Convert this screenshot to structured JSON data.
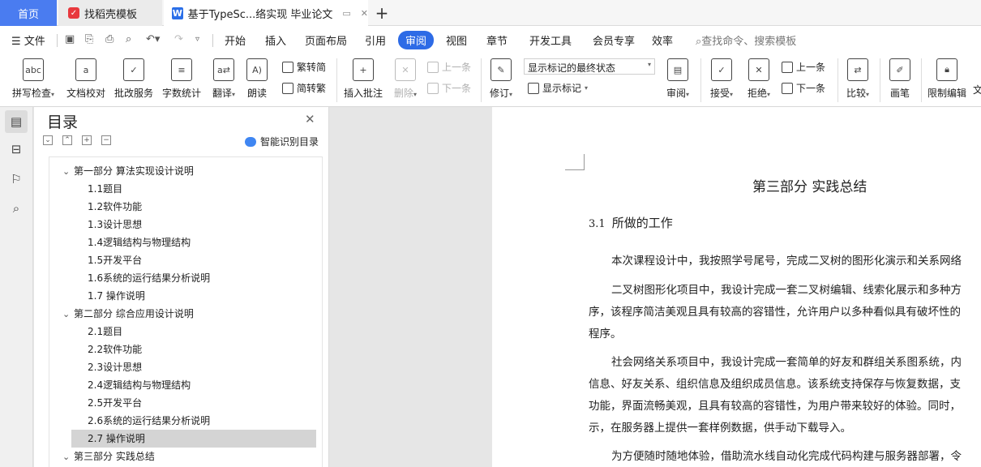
{
  "tabs": {
    "home": "首页",
    "template": "找稻壳模板",
    "document": "基于TypeSc...络实现 毕业论文"
  },
  "menu": {
    "file": "文件",
    "items": [
      "开始",
      "插入",
      "页面布局",
      "引用",
      "审阅",
      "视图",
      "章节",
      "开发工具",
      "会员专享",
      "效率"
    ],
    "active": "审阅",
    "search_placeholder": "查找命令、搜索模板"
  },
  "ribbon": {
    "spell_check": "拼写检查",
    "doc_proofread": "文档校对",
    "batch_service": "批改服务",
    "word_count": "字数统计",
    "translate": "翻译",
    "read_aloud": "朗读",
    "to_traditional": "繁转简",
    "to_simplified": "简转繁",
    "insert_comment": "插入批注",
    "delete": "删除",
    "prev_comment": "上一条",
    "next_comment": "下一条",
    "track_changes": "修订",
    "markup_mode": "显示标记的最终状态",
    "show_markup": "显示标记",
    "review": "审阅",
    "accept": "接受",
    "reject": "拒绝",
    "prev_change": "上一条",
    "next_change": "下一条",
    "compare": "比较",
    "pen": "画笔",
    "restrict_edit": "限制编辑",
    "doc_truncated": "文"
  },
  "toc": {
    "title": "目录",
    "smart_button": "智能识别目录",
    "items": [
      {
        "label": "第一部分 算法实现设计说明",
        "level": 1
      },
      {
        "label": "1.1题目",
        "level": 2
      },
      {
        "label": "1.2软件功能",
        "level": 2
      },
      {
        "label": "1.3设计思想",
        "level": 2
      },
      {
        "label": "1.4逻辑结构与物理结构",
        "level": 2
      },
      {
        "label": "1.5开发平台",
        "level": 2
      },
      {
        "label": "1.6系统的运行结果分析说明",
        "level": 2
      },
      {
        "label": "1.7 操作说明",
        "level": 2
      },
      {
        "label": "第二部分 综合应用设计说明",
        "level": 1
      },
      {
        "label": "2.1题目",
        "level": 2
      },
      {
        "label": "2.2软件功能",
        "level": 2
      },
      {
        "label": "2.3设计思想",
        "level": 2
      },
      {
        "label": "2.4逻辑结构与物理结构",
        "level": 2
      },
      {
        "label": "2.5开发平台",
        "level": 2
      },
      {
        "label": "2.6系统的运行结果分析说明",
        "level": 2
      },
      {
        "label": "2.7 操作说明",
        "level": 2,
        "selected": true
      },
      {
        "label": "第三部分 实践总结",
        "level": 1
      }
    ]
  },
  "document": {
    "heading": "第三部分 实践总结",
    "section_number": "3.1",
    "section_title": "所做的工作",
    "lines": [
      "本次课程设计中，我按照学号尾号，完成二叉树的图形化演示和关系网络",
      "二叉树图形化项目中，我设计完成一套二叉树编辑、线索化展示和多种方",
      "序，该程序简洁美观且具有较高的容错性，允许用户以多种看似具有破坏性的",
      "程序。",
      "社会网络关系项目中，我设计完成一套简单的好友和群组关系图系统，内",
      "信息、好友关系、组织信息及组织成员信息。该系统支持保存与恢复数据，支",
      "功能，界面流畅美观，且具有较高的容错性，为用户带来较好的体验。同时，",
      "示，在服务器上提供一套样例数据，供手动下载导入。",
      "为方便随时随地体验，借助流水线自动化完成代码构建与服务器部署，令"
    ]
  }
}
